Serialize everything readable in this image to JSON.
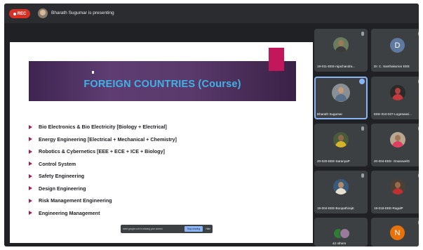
{
  "topbar": {
    "rec_label": "REC",
    "presenter_text": "Bharath Sugumar is presenting"
  },
  "slide": {
    "title": "FOREIGN COUNTRIES  (Course)",
    "bullets": [
      "Bio Electronics & Bio Electricity [Biology + Electrical]",
      "Energy Engineering [Electrical + Mechanical + Chemistry]",
      "Robotics & Cybernetics [EEE + ECE + ICE + Biology]",
      "Control System",
      "Safety Engineering",
      "Design Engineering",
      "Risk Management Engineering",
      "Engineering Management"
    ],
    "banner_color": "#4a2c5e",
    "title_color": "#3fb2e8",
    "accent_color": "#c2185b"
  },
  "share_bar": {
    "text": "meet.google.com is sharing your screen.",
    "stop_label": "Stop sharing",
    "hide_label": "Hide"
  },
  "participants": [
    {
      "name": "19-011-EEE-rajachandra...",
      "type": "photo"
    },
    {
      "name": "Dr. C. Santhakumar EEE",
      "type": "initial",
      "initial": "D",
      "color": "#5f7a9e"
    },
    {
      "name": "Bharath Sugumar",
      "type": "photo"
    },
    {
      "name": "EEE-010-027-Logeswari...",
      "type": "photo"
    },
    {
      "name": "20-020-EEE-SaranyaP",
      "type": "photo"
    },
    {
      "name": "20-004-EEE- GnanavelG",
      "type": "photo"
    },
    {
      "name": "19-004-EEE-BoopathirajK",
      "type": "photo"
    },
    {
      "name": "19-018-EEE-RagulP",
      "type": "photo"
    },
    {
      "name": "42 others",
      "type": "group"
    },
    {
      "name": "",
      "type": "initial",
      "initial": "N",
      "color": "#e8710a"
    }
  ]
}
